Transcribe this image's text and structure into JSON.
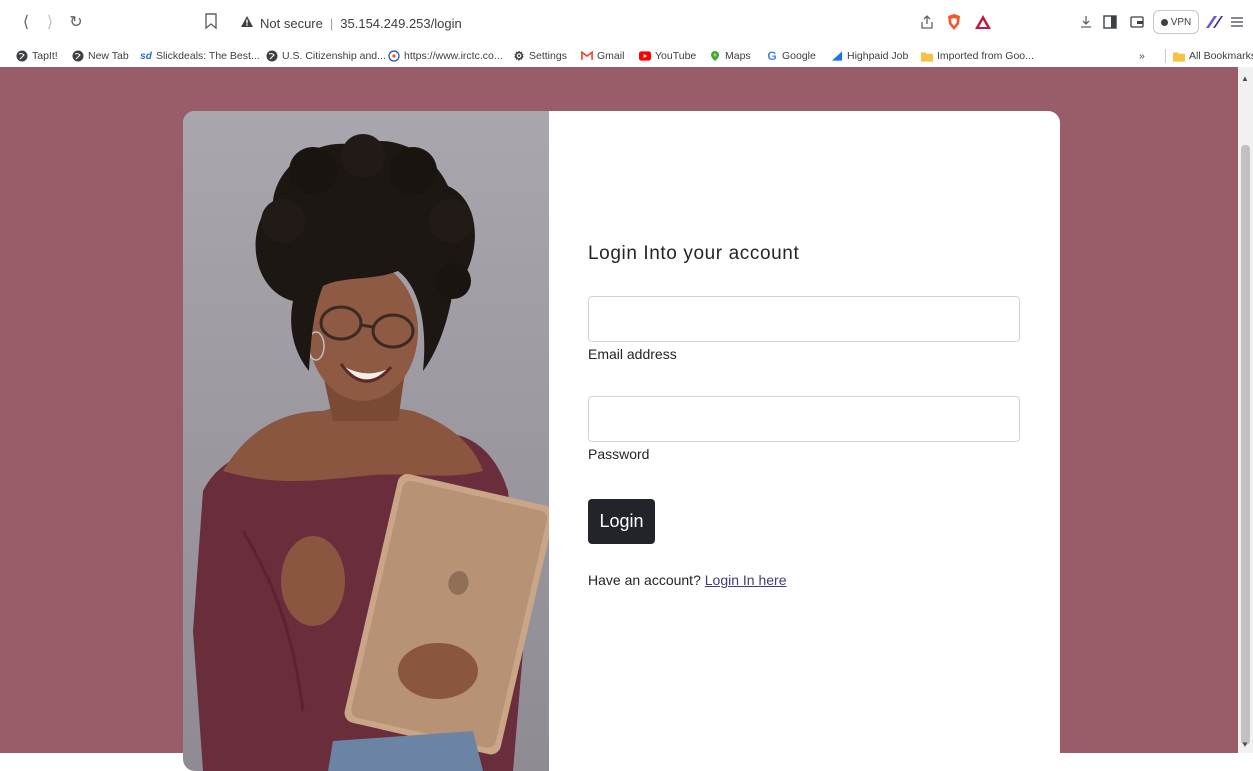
{
  "browser": {
    "address": {
      "security_label": "Not secure",
      "url": "35.154.249.253/login"
    },
    "vpn_label": "VPN"
  },
  "bookmarks": {
    "items": [
      {
        "label": "TapIt!",
        "icon": "globe-icon"
      },
      {
        "label": "New Tab",
        "icon": "globe-icon"
      },
      {
        "label": "Slickdeals: The Best...",
        "icon": "slickdeals-icon"
      },
      {
        "label": "U.S. Citizenship and...",
        "icon": "globe-icon"
      },
      {
        "label": "https://www.irctc.co...",
        "icon": "irctc-icon"
      },
      {
        "label": "Settings",
        "icon": "gear-icon"
      },
      {
        "label": "Gmail",
        "icon": "gmail-icon"
      },
      {
        "label": "YouTube",
        "icon": "youtube-icon"
      },
      {
        "label": "Maps",
        "icon": "maps-icon"
      },
      {
        "label": "Google",
        "icon": "google-icon"
      },
      {
        "label": "Highpaid Job",
        "icon": "highpaid-icon"
      },
      {
        "label": "Imported from Goo...",
        "icon": "folder-icon"
      }
    ],
    "overflow_label": "»",
    "all_bookmarks_label": "All Bookmarks"
  },
  "login": {
    "title": "Login Into your account",
    "email": {
      "label": "Email address",
      "value": ""
    },
    "password": {
      "label": "Password",
      "value": ""
    },
    "submit_label": "Login",
    "footer_text": "Have an account?",
    "footer_link": "Login In here"
  },
  "colors": {
    "page_background": "#985d68",
    "button": "#212529",
    "link": "#393f81"
  }
}
